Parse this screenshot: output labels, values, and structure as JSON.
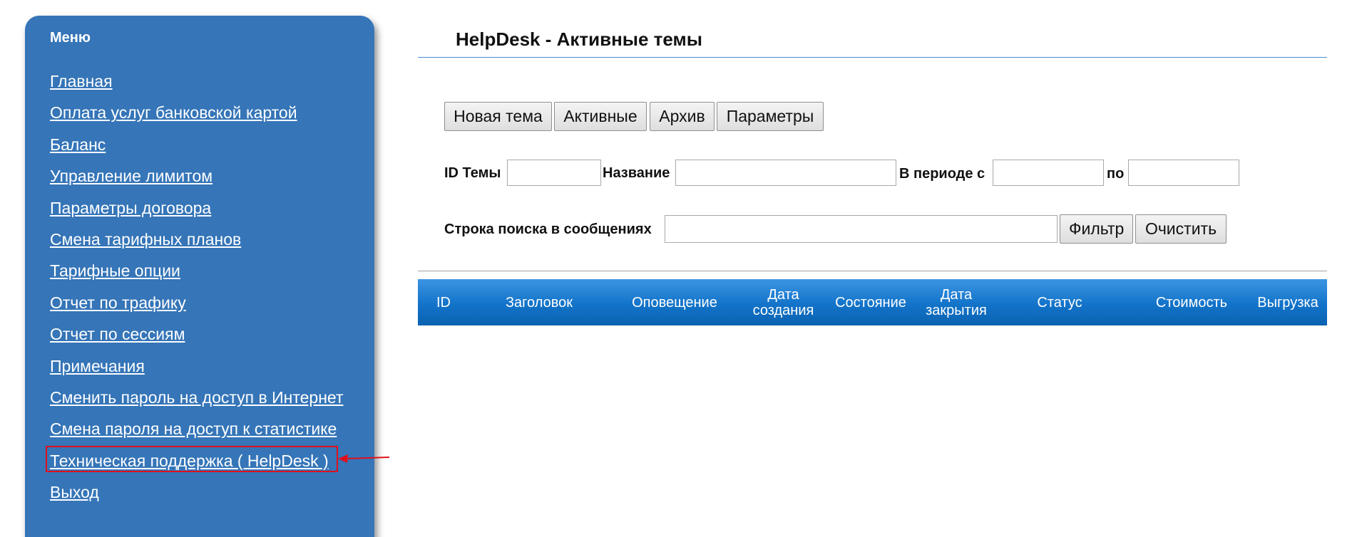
{
  "sidebar": {
    "title": "Меню",
    "items": [
      {
        "label": "Главная"
      },
      {
        "label": "Оплата услуг банковской картой"
      },
      {
        "label": "Баланс"
      },
      {
        "label": "Управление лимитом"
      },
      {
        "label": "Параметры договора"
      },
      {
        "label": "Смена тарифных планов"
      },
      {
        "label": "Тарифные опции"
      },
      {
        "label": "Отчет по трафику"
      },
      {
        "label": "Отчет по сессиям"
      },
      {
        "label": "Примечания"
      },
      {
        "label": "Сменить пароль на доступ в Интернет"
      },
      {
        "label": "Смена пароля на доступ к статистике"
      },
      {
        "label": "Техническая поддержка ( HelpDesk )",
        "highlighted": true
      },
      {
        "label": "Выход"
      }
    ]
  },
  "colors": {
    "sidebar_bg": "#3575b8",
    "highlight": "#e0111c",
    "table_header": "#1273c9",
    "title_rule": "#4c8fd3"
  },
  "main": {
    "title": "HelpDesk - Активные темы",
    "tabs": {
      "new_topic": "Новая тема",
      "active": "Активные",
      "archive": "Архив",
      "params": "Параметры"
    },
    "filters": {
      "topic_id_label": "ID Темы",
      "topic_id_value": "",
      "name_label": "Название",
      "name_value": "",
      "period_from_label": "В периоде с",
      "period_from_value": "",
      "period_to_label": "по",
      "period_to_value": "",
      "search_label": "Строка поиска в сообщениях",
      "search_value": "",
      "filter_button": "Фильтр",
      "clear_button": "Очистить"
    },
    "table": {
      "columns": {
        "id": "ID",
        "header": "Заголовок",
        "notification": "Оповещение",
        "created_line1": "Дата",
        "created_line2": "создания",
        "state": "Состояние",
        "closed_line1": "Дата",
        "closed_line2": "закрытия",
        "status": "Статус",
        "cost": "Стоимость",
        "export": "Выгрузка"
      },
      "rows": []
    }
  }
}
